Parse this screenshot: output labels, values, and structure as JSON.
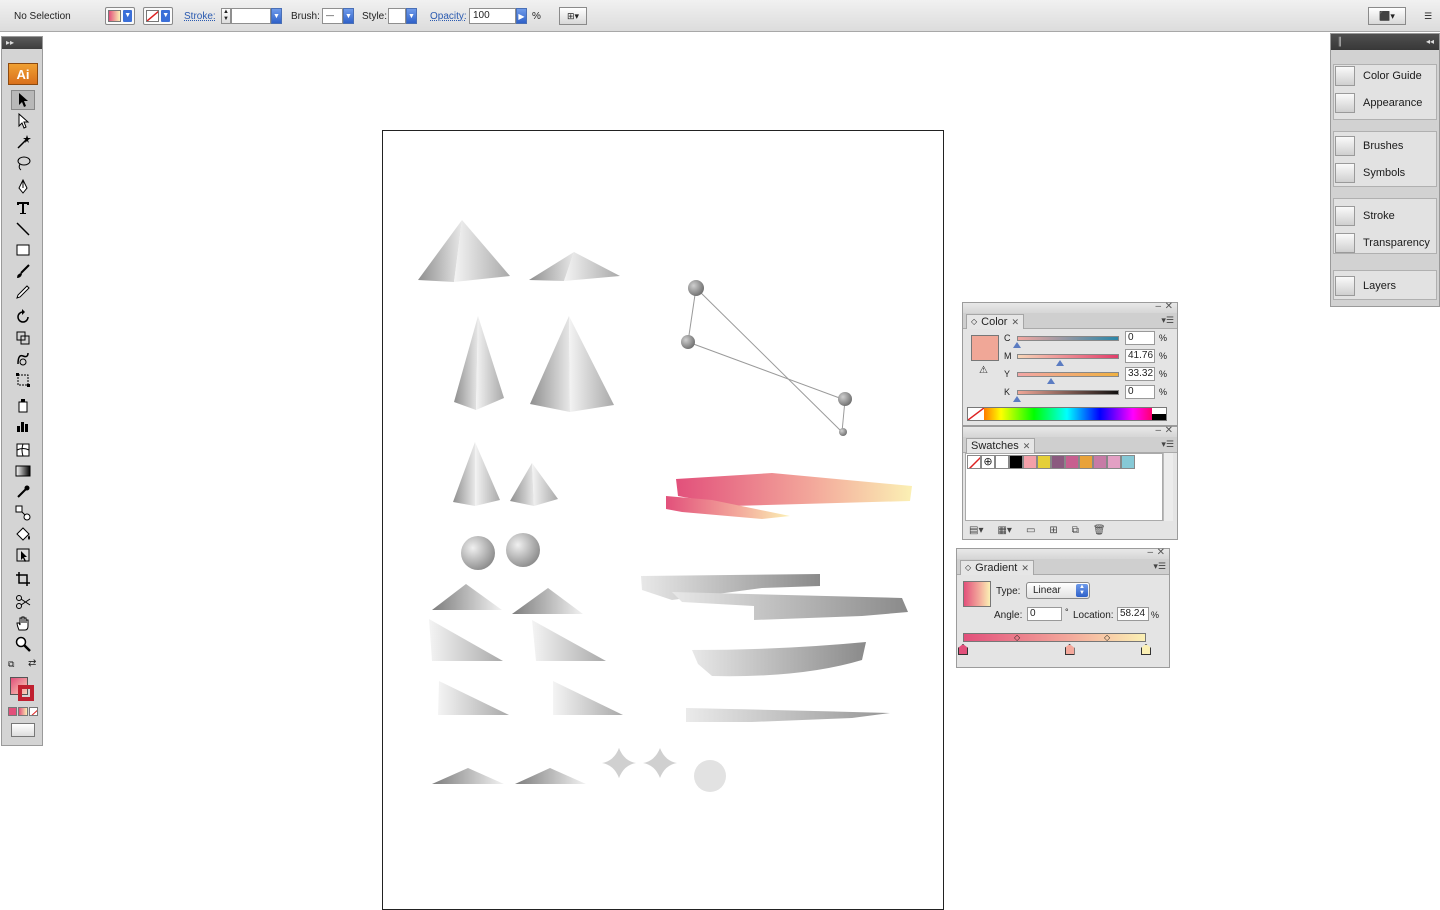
{
  "control_bar": {
    "selection_status": "No Selection",
    "stroke_label": "Stroke:",
    "brush_label": "Brush:",
    "style_label": "Style:",
    "opacity_label": "Opacity:",
    "opacity_value": "100",
    "opacity_unit": "%"
  },
  "tools": {
    "logo_text": "Ai",
    "collapse_glyph": "▸▸",
    "icons": [
      "selection-tool",
      "direct-selection-tool",
      "magic-wand-tool",
      "lasso-tool",
      "pen-tool",
      "type-tool",
      "line-segment-tool",
      "rectangle-tool",
      "paintbrush-tool",
      "pencil-tool",
      "rotate-tool",
      "scale-tool",
      "warp-tool",
      "free-transform-tool",
      "symbol-sprayer-tool",
      "column-graph-tool",
      "mesh-tool",
      "gradient-tool",
      "eyedropper-tool",
      "blend-tool",
      "live-paint-bucket-tool",
      "live-paint-selection-tool",
      "crop-area-tool",
      "scissors-tool",
      "hand-tool",
      "zoom-tool"
    ]
  },
  "color_panel": {
    "tab_label": "Color",
    "channels": [
      {
        "label": "C",
        "value": "0",
        "unit": "%",
        "level": 0
      },
      {
        "label": "M",
        "value": "41.76",
        "unit": "%",
        "level": 0.4176
      },
      {
        "label": "Y",
        "value": "33.32",
        "unit": "%",
        "level": 0.3332
      },
      {
        "label": "K",
        "value": "0",
        "unit": "%",
        "level": 0
      }
    ],
    "fill_color": "#f0a797"
  },
  "swatches_panel": {
    "tab_label": "Swatches",
    "swatch_colors": [
      "#ffffff",
      "#000000",
      "#f3a0a9",
      "#e5cf38",
      "#8b5a7f",
      "#c75f8f",
      "#e8a23a",
      "#c77ba6",
      "#e3a0c4",
      "#86c9d6"
    ]
  },
  "gradient_panel": {
    "tab_label": "Gradient",
    "type_label": "Type:",
    "type_value": "Linear",
    "angle_label": "Angle:",
    "angle_value": "0",
    "angle_unit": "°",
    "location_label": "Location:",
    "location_value": "58.24",
    "location_unit": "%",
    "stop_colors": [
      "#e2507b",
      "#f3a89b",
      "#fbf0b4"
    ]
  },
  "dock": {
    "items": [
      {
        "label": "Color Guide",
        "icon": "color-guide-icon"
      },
      {
        "label": "Appearance",
        "icon": "appearance-icon"
      },
      {
        "label": "Brushes",
        "icon": "brushes-icon"
      },
      {
        "label": "Symbols",
        "icon": "symbols-icon"
      },
      {
        "label": "Stroke",
        "icon": "stroke-icon"
      },
      {
        "label": "Transparency",
        "icon": "transparency-icon"
      },
      {
        "label": "Layers",
        "icon": "layers-icon"
      }
    ]
  },
  "colors": {
    "accent_blue": "#2f61c9",
    "brand_orange": "#d9701c",
    "pink": "#e2507b",
    "cream": "#fbf0b4"
  }
}
